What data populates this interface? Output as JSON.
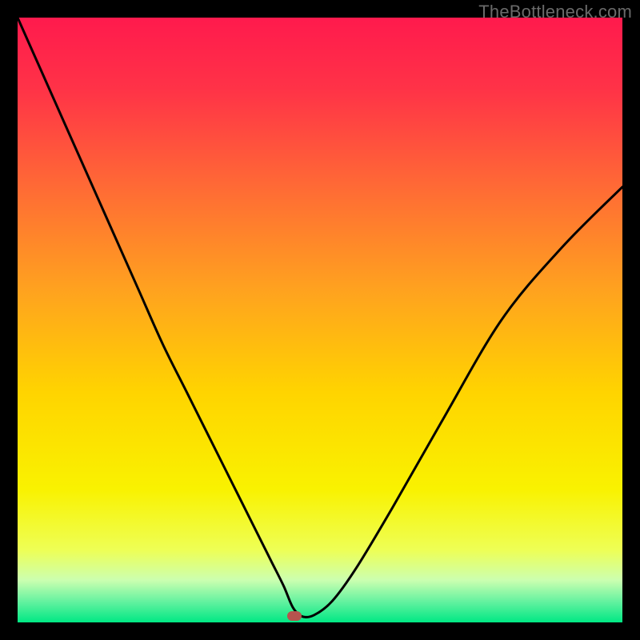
{
  "watermark": {
    "text": "TheBottleneck.com"
  },
  "colors": {
    "frame": "#000000",
    "curve": "#000000",
    "marker": "#b7534e",
    "gradient_stops": [
      {
        "stop": 0,
        "color": "#ff1a4d"
      },
      {
        "stop": 0.12,
        "color": "#ff3347"
      },
      {
        "stop": 0.28,
        "color": "#ff6a35"
      },
      {
        "stop": 0.45,
        "color": "#ffa21f"
      },
      {
        "stop": 0.62,
        "color": "#ffd400"
      },
      {
        "stop": 0.78,
        "color": "#f9f200"
      },
      {
        "stop": 0.88,
        "color": "#eeff55"
      },
      {
        "stop": 0.93,
        "color": "#ccffb0"
      },
      {
        "stop": 0.965,
        "color": "#66f2a0"
      },
      {
        "stop": 1.0,
        "color": "#00e884"
      }
    ]
  },
  "chart_data": {
    "type": "line",
    "title": "",
    "xlabel": "",
    "ylabel": "",
    "xlim": [
      0,
      100
    ],
    "ylim": [
      0,
      100
    ],
    "grid": false,
    "legend": false,
    "series": [
      {
        "name": "bottleneck-curve",
        "x": [
          0,
          4,
          8,
          12,
          16,
          20,
          24,
          28,
          32,
          36,
          40,
          42,
          44,
          45.5,
          47,
          49,
          52,
          56,
          62,
          70,
          80,
          90,
          100
        ],
        "y": [
          100,
          91,
          82,
          73,
          64,
          55,
          46,
          38,
          30,
          22,
          14,
          10,
          6,
          2.5,
          1.0,
          1.2,
          3.5,
          9,
          19,
          33,
          50,
          62,
          72
        ]
      }
    ],
    "annotations": [
      {
        "name": "optimal-marker",
        "x": 45.8,
        "y": 1.0
      }
    ]
  }
}
